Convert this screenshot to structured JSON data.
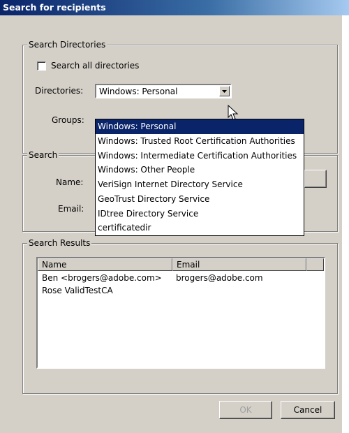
{
  "window": {
    "title": "Search for recipients"
  },
  "search_directories": {
    "legend": "Search Directories",
    "search_all_label": "Search all directories",
    "directories_label": "Directories:",
    "directories_selected": "Windows: Personal",
    "groups_label": "Groups:",
    "options": [
      "Windows: Personal",
      "Windows: Trusted Root Certification Authorities",
      "Windows: Intermediate Certification Authorities",
      "Windows: Other People",
      "VeriSign Internet Directory Service",
      "GeoTrust Directory Service",
      "IDtree Directory Service",
      "certificatedir"
    ]
  },
  "search": {
    "legend": "Search",
    "name_label": "Name:",
    "email_label": "Email:"
  },
  "results": {
    "legend": "Search Results",
    "columns": [
      "Name",
      "Email"
    ],
    "rows": [
      [
        "Ben <brogers@adobe.com>",
        "brogers@adobe.com"
      ],
      [
        "Rose ValidTestCA",
        ""
      ]
    ]
  },
  "footer": {
    "ok": "OK",
    "cancel": "Cancel"
  }
}
